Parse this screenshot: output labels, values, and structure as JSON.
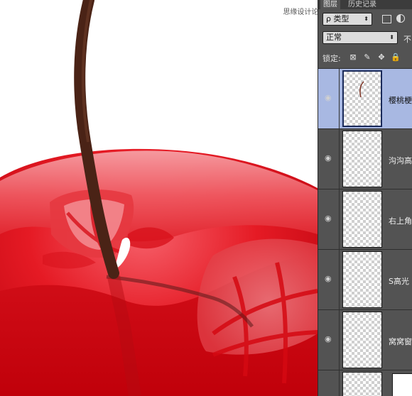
{
  "watermark": "思缘设计论坛  WWW.MISSYUAN.COM",
  "panel": {
    "tabs": [
      "图层",
      "历史记录"
    ],
    "filter": {
      "label": "类型",
      "prefix": "ρ"
    },
    "blend_mode": "正常",
    "opacity_label": "不",
    "lock_label": "锁定:",
    "layers": [
      {
        "name": "樱桃梗",
        "selected": true
      },
      {
        "name": "沟沟高",
        "selected": false
      },
      {
        "name": "右上角",
        "selected": false
      },
      {
        "name": "S高光",
        "selected": false
      },
      {
        "name": "窝窝窗",
        "selected": false
      }
    ]
  },
  "colors": {
    "selected_layer": "#a8b8e2",
    "panel_bg": "#535353",
    "cherry_red": "#d90a12",
    "stem": "#4a2316"
  }
}
